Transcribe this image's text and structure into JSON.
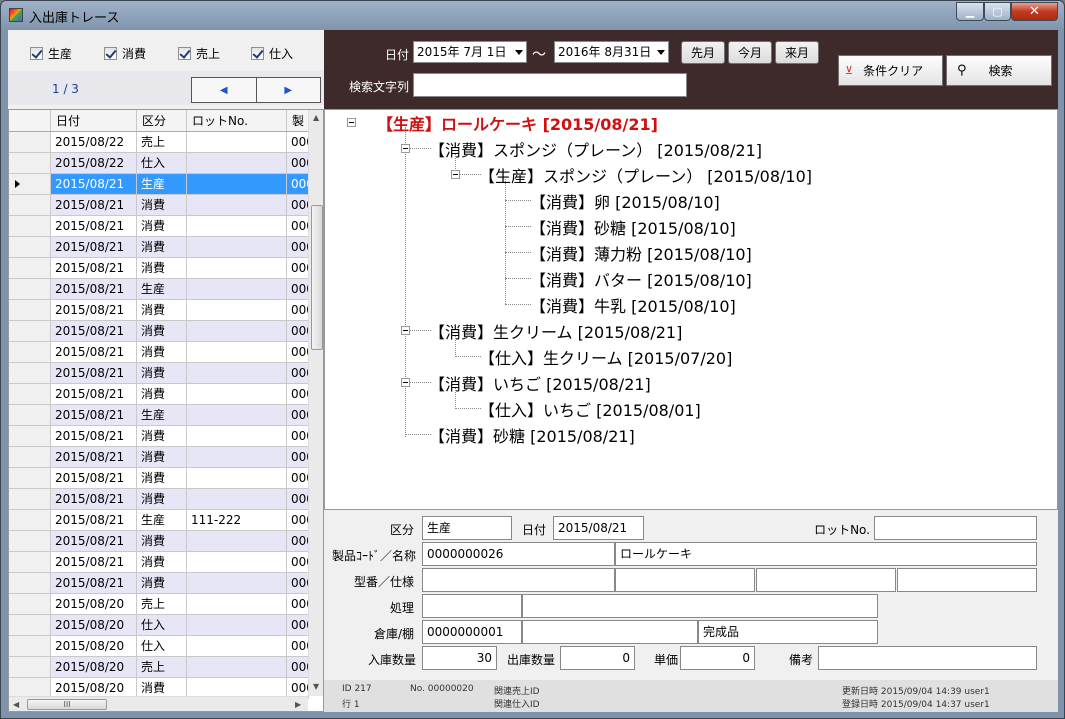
{
  "window": {
    "title": "入出庫トレース",
    "min": "▁",
    "max": "▢",
    "close": "✕"
  },
  "filters": [
    {
      "label": "生産",
      "checked": true
    },
    {
      "label": "消費",
      "checked": true
    },
    {
      "label": "売上",
      "checked": true
    },
    {
      "label": "仕入",
      "checked": true
    }
  ],
  "pager": {
    "text": "1 / 3",
    "prev": "◀",
    "next": "▶"
  },
  "grid": {
    "headers": [
      "日付",
      "区分",
      "ロットNo.",
      "製"
    ],
    "rows": [
      [
        "2015/08/22",
        "売上",
        "",
        "000"
      ],
      [
        "2015/08/22",
        "仕入",
        "",
        "000"
      ],
      [
        "2015/08/21",
        "生産",
        "",
        "000"
      ],
      [
        "2015/08/21",
        "消費",
        "",
        "000"
      ],
      [
        "2015/08/21",
        "消費",
        "",
        "000"
      ],
      [
        "2015/08/21",
        "消費",
        "",
        "000"
      ],
      [
        "2015/08/21",
        "消費",
        "",
        "000"
      ],
      [
        "2015/08/21",
        "生産",
        "",
        "000"
      ],
      [
        "2015/08/21",
        "消費",
        "",
        "000"
      ],
      [
        "2015/08/21",
        "消費",
        "",
        "000"
      ],
      [
        "2015/08/21",
        "消費",
        "",
        "000"
      ],
      [
        "2015/08/21",
        "消費",
        "",
        "000"
      ],
      [
        "2015/08/21",
        "消費",
        "",
        "000"
      ],
      [
        "2015/08/21",
        "生産",
        "",
        "000"
      ],
      [
        "2015/08/21",
        "消費",
        "",
        "000"
      ],
      [
        "2015/08/21",
        "消費",
        "",
        "000"
      ],
      [
        "2015/08/21",
        "消費",
        "",
        "000"
      ],
      [
        "2015/08/21",
        "消費",
        "",
        "000"
      ],
      [
        "2015/08/21",
        "生産",
        "111-222",
        "000"
      ],
      [
        "2015/08/21",
        "消費",
        "",
        "000"
      ],
      [
        "2015/08/21",
        "消費",
        "",
        "000"
      ],
      [
        "2015/08/21",
        "消費",
        "",
        "000"
      ],
      [
        "2015/08/20",
        "売上",
        "",
        "000"
      ],
      [
        "2015/08/20",
        "仕入",
        "",
        "000"
      ],
      [
        "2015/08/20",
        "仕入",
        "",
        "000"
      ],
      [
        "2015/08/20",
        "売上",
        "",
        "000"
      ],
      [
        "2015/08/20",
        "消費",
        "",
        "000"
      ]
    ],
    "selected_index": 2,
    "hthumb": "III",
    "scroll_left": "◀",
    "scroll_right": "▶",
    "scroll_up": "▲",
    "scroll_down": "▼"
  },
  "search": {
    "date_label": "日付",
    "date_from": "2015年  7月  1日",
    "tilde": "〜",
    "date_to": "2016年  8月31日",
    "prev_month": "先月",
    "this_month": "今月",
    "next_month": "来月",
    "keyword_label": "検索文字列",
    "keyword_value": "",
    "clear_label": "条件クリア",
    "search_label": "検索"
  },
  "tree": [
    {
      "text": "【生産】ロールケーキ [2015/08/21]",
      "root": true
    },
    {
      "text": "【消費】スポンジ（プレーン） [2015/08/21]"
    },
    {
      "text": "【生産】スポンジ（プレーン） [2015/08/10]"
    },
    {
      "text": "【消費】卵 [2015/08/10]"
    },
    {
      "text": "【消費】砂糖 [2015/08/10]"
    },
    {
      "text": "【消費】薄力粉 [2015/08/10]"
    },
    {
      "text": "【消費】バター [2015/08/10]"
    },
    {
      "text": "【消費】牛乳 [2015/08/10]"
    },
    {
      "text": "【消費】生クリーム [2015/08/21]"
    },
    {
      "text": "【仕入】生クリーム [2015/07/20]"
    },
    {
      "text": "【消費】いちご [2015/08/21]"
    },
    {
      "text": "【仕入】いちご [2015/08/01]"
    },
    {
      "text": "【消費】砂糖 [2015/08/21]"
    }
  ],
  "detail": {
    "kubun_label": "区分",
    "kubun": "生産",
    "date_label": "日付",
    "date": "2015/08/21",
    "lot_label": "ロットNo.",
    "lot": "",
    "product_label": "製品ｺｰﾄﾞ／名称",
    "product_code": "0000000026",
    "product_name": "ロールケーキ",
    "model_label": "型番／仕様",
    "process_label": "処理",
    "warehouse_label": "倉庫/棚",
    "warehouse_code": "0000000001",
    "warehouse_name": "",
    "shelf": "完成品",
    "in_qty_label": "入庫数量",
    "in_qty": "30",
    "out_qty_label": "出庫数量",
    "out_qty": "0",
    "price_label": "単価",
    "price": "0",
    "remarks_label": "備考",
    "remarks": ""
  },
  "status": {
    "id": "ID  217",
    "no": "No. 00000020",
    "related_sales": "関連売上ID",
    "row": "行  1",
    "related_purchase": "関連仕入ID",
    "updated": "更新日時  2015/09/04 14:39   user1",
    "registered": "登録日時  2015/09/04 14:37   user1"
  }
}
